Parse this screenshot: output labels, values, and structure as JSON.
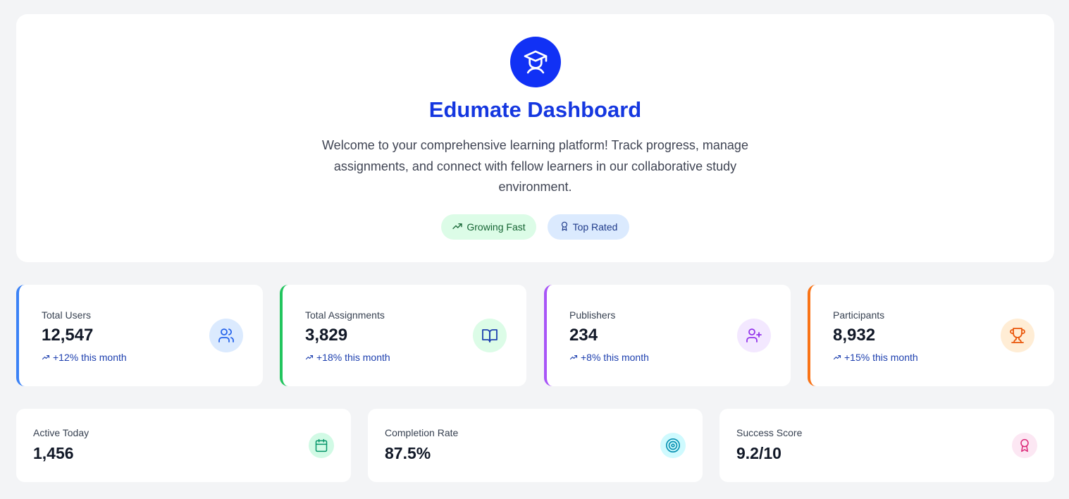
{
  "hero": {
    "title": "Edumate Dashboard",
    "description": "Welcome to your comprehensive learning platform! Track progress, manage assignments, and connect with fellow learners in our collaborative study environment.",
    "badges": [
      {
        "label": "Growing Fast",
        "icon": "trending-up-icon"
      },
      {
        "label": "Top Rated",
        "icon": "award-icon"
      }
    ],
    "logo_icon": "graduation-cap-icon",
    "brand_color": "#1131f5"
  },
  "stats": [
    {
      "label": "Total Users",
      "value": "12,547",
      "trend": "+12% this month",
      "icon": "users-icon",
      "accent": "#3b82f6"
    },
    {
      "label": "Total Assignments",
      "value": "3,829",
      "trend": "+18% this month",
      "icon": "book-open-icon",
      "accent": "#22c55e"
    },
    {
      "label": "Publishers",
      "value": "234",
      "trend": "+8% this month",
      "icon": "user-plus-icon",
      "accent": "#a855f7"
    },
    {
      "label": "Participants",
      "value": "8,932",
      "trend": "+15% this month",
      "icon": "trophy-icon",
      "accent": "#f97316"
    }
  ],
  "metrics": [
    {
      "label": "Active Today",
      "value": "1,456",
      "icon": "calendar-icon"
    },
    {
      "label": "Completion Rate",
      "value": "87.5%",
      "icon": "target-icon"
    },
    {
      "label": "Success Score",
      "value": "9.2/10",
      "icon": "award-icon"
    }
  ]
}
